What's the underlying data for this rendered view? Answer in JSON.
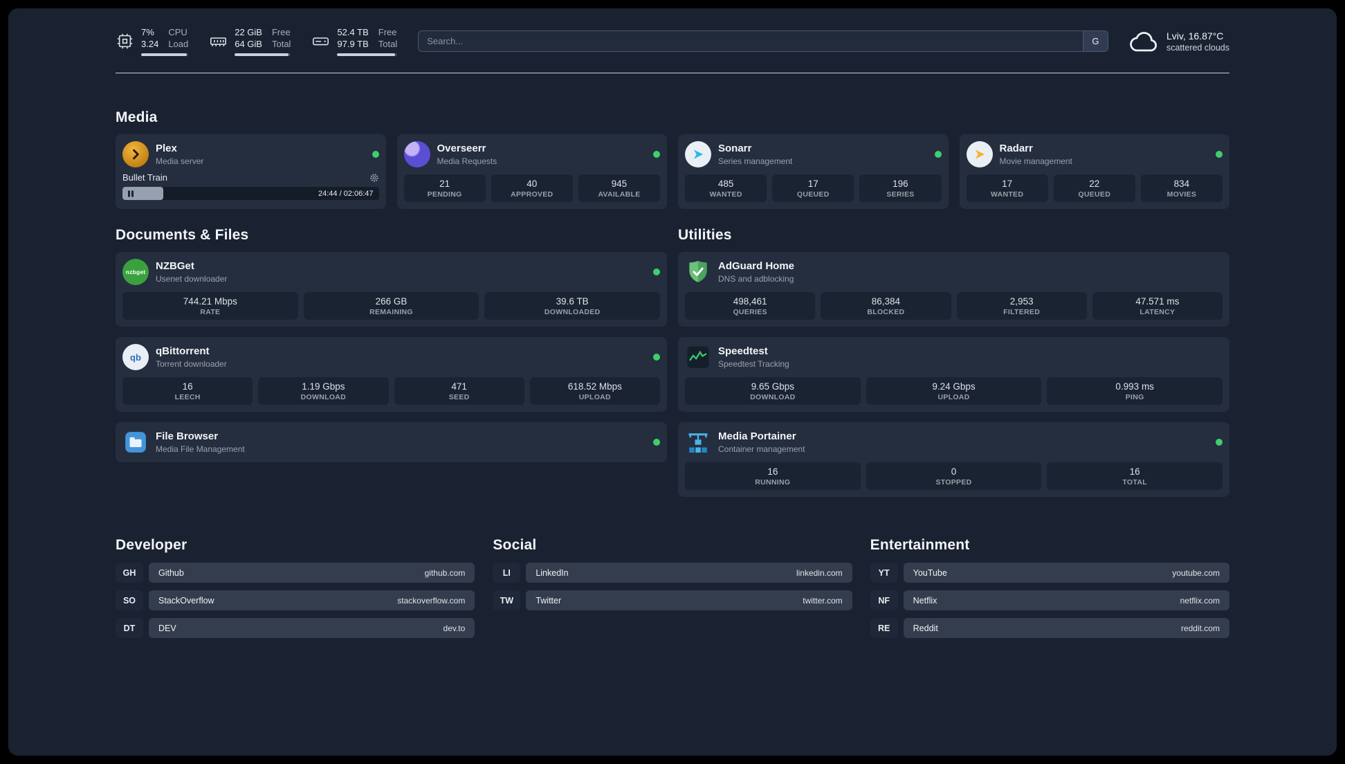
{
  "topbar": {
    "cpu": {
      "value1": "7%",
      "value2": "3.24",
      "label1": "CPU",
      "label2": "Load"
    },
    "ram": {
      "value1": "22 GiB",
      "value2": "64 GiB",
      "label1": "Free",
      "label2": "Total"
    },
    "disk": {
      "value1": "52.4 TB",
      "value2": "97.9 TB",
      "label1": "Free",
      "label2": "Total"
    },
    "search": {
      "placeholder": "Search...",
      "engine_label": "G"
    },
    "weather": {
      "location": "Lviv, 16.87°C",
      "condition": "scattered clouds"
    }
  },
  "media": {
    "title": "Media",
    "plex": {
      "name": "Plex",
      "subtitle": "Media server",
      "track": "Bullet Train",
      "time": "24:44 / 02:06:47",
      "progress_percent": 16
    },
    "overseerr": {
      "name": "Overseerr",
      "subtitle": "Media Requests",
      "stats": [
        {
          "value": "21",
          "label": "PENDING"
        },
        {
          "value": "40",
          "label": "APPROVED"
        },
        {
          "value": "945",
          "label": "AVAILABLE"
        }
      ]
    },
    "sonarr": {
      "name": "Sonarr",
      "subtitle": "Series management",
      "stats": [
        {
          "value": "485",
          "label": "WANTED"
        },
        {
          "value": "17",
          "label": "QUEUED"
        },
        {
          "value": "196",
          "label": "SERIES"
        }
      ]
    },
    "radarr": {
      "name": "Radarr",
      "subtitle": "Movie management",
      "stats": [
        {
          "value": "17",
          "label": "WANTED"
        },
        {
          "value": "22",
          "label": "QUEUED"
        },
        {
          "value": "834",
          "label": "MOVIES"
        }
      ]
    }
  },
  "documents": {
    "title": "Documents & Files",
    "nzbget": {
      "name": "NZBGet",
      "subtitle": "Usenet downloader",
      "icon_text": "nzbget",
      "stats": [
        {
          "value": "744.21 Mbps",
          "label": "RATE"
        },
        {
          "value": "266 GB",
          "label": "REMAINING"
        },
        {
          "value": "39.6 TB",
          "label": "DOWNLOADED"
        }
      ]
    },
    "qbittorrent": {
      "name": "qBittorrent",
      "subtitle": "Torrent downloader",
      "icon_text": "qb",
      "stats": [
        {
          "value": "16",
          "label": "LEECH"
        },
        {
          "value": "1.19 Gbps",
          "label": "DOWNLOAD"
        },
        {
          "value": "471",
          "label": "SEED"
        },
        {
          "value": "618.52 Mbps",
          "label": "UPLOAD"
        }
      ]
    },
    "filebrowser": {
      "name": "File Browser",
      "subtitle": "Media File Management"
    }
  },
  "utilities": {
    "title": "Utilities",
    "adguard": {
      "name": "AdGuard Home",
      "subtitle": "DNS and adblocking",
      "stats": [
        {
          "value": "498,461",
          "label": "QUERIES"
        },
        {
          "value": "86,384",
          "label": "BLOCKED"
        },
        {
          "value": "2,953",
          "label": "FILTERED"
        },
        {
          "value": "47.571 ms",
          "label": "LATENCY"
        }
      ]
    },
    "speedtest": {
      "name": "Speedtest",
      "subtitle": "Speedtest Tracking",
      "stats": [
        {
          "value": "9.65 Gbps",
          "label": "DOWNLOAD"
        },
        {
          "value": "9.24 Gbps",
          "label": "UPLOAD"
        },
        {
          "value": "0.993 ms",
          "label": "PING"
        }
      ]
    },
    "portainer": {
      "name": "Media Portainer",
      "subtitle": "Container management",
      "stats": [
        {
          "value": "16",
          "label": "RUNNING"
        },
        {
          "value": "0",
          "label": "STOPPED"
        },
        {
          "value": "16",
          "label": "TOTAL"
        }
      ]
    }
  },
  "bookmarks": [
    {
      "title": "Developer",
      "items": [
        {
          "abbr": "GH",
          "name": "Github",
          "domain": "github.com"
        },
        {
          "abbr": "SO",
          "name": "StackOverflow",
          "domain": "stackoverflow.com"
        },
        {
          "abbr": "DT",
          "name": "DEV",
          "domain": "dev.to"
        }
      ]
    },
    {
      "title": "Social",
      "items": [
        {
          "abbr": "LI",
          "name": "LinkedIn",
          "domain": "linkedin.com"
        },
        {
          "abbr": "TW",
          "name": "Twitter",
          "domain": "twitter.com"
        }
      ]
    },
    {
      "title": "Entertainment",
      "items": [
        {
          "abbr": "YT",
          "name": "YouTube",
          "domain": "youtube.com"
        },
        {
          "abbr": "NF",
          "name": "Netflix",
          "domain": "netflix.com"
        },
        {
          "abbr": "RE",
          "name": "Reddit",
          "domain": "reddit.com"
        }
      ]
    }
  ],
  "colors": {
    "status_online": "#3ed06a",
    "plex": "#e5a00d",
    "overseerr": "#5a4fd3",
    "sonarr": "#28b8e8",
    "radarr": "#f7b32b",
    "nzbget": "#3aa23d",
    "qbittorrent": "#2d6fc6",
    "filebrowser": "#4295da",
    "adguard": "#57b05f",
    "speedtest": "#2fd272",
    "portainer": "#4ab3ea"
  }
}
